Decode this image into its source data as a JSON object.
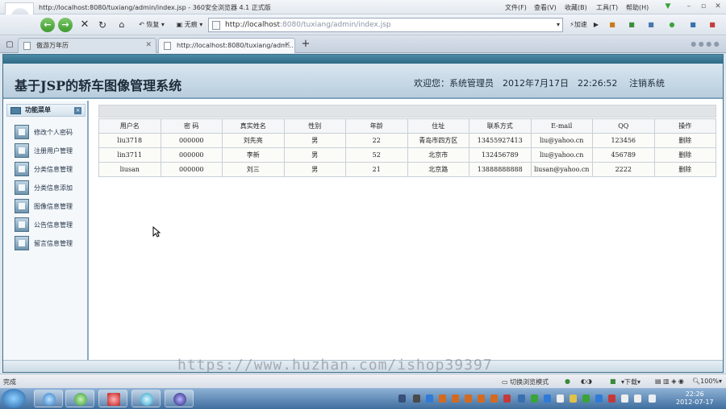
{
  "browser": {
    "title": "http://localhost:8080/tuxiang/admin/index.jsp - 360安全浏览器 4.1 正式版",
    "menu": [
      "文件(F)",
      "查看(V)",
      "收藏(B)",
      "工具(T)",
      "帮助(H)"
    ],
    "url_host": "http://localhost",
    "url_rest": ":8080/tuxiang/admin/index.jsp",
    "nav_back_label": "恢复",
    "nav_no_trace_label": "无痕",
    "accelerate_label": "加速",
    "tabs": [
      {
        "label": "傲游万年历"
      },
      {
        "label": "http://localhost:8080/tuxiang/adm..."
      }
    ]
  },
  "app": {
    "system_name": "基于JSP的轿车图像管理系统",
    "welcome": "欢迎您：系统管理员　2012年7月17日　22:26:52",
    "logout": "注销系统",
    "sidebar_title": "功能菜单",
    "sidebar_items": [
      {
        "label": "修改个人密码"
      },
      {
        "label": "注册用户管理"
      },
      {
        "label": "分类信息管理"
      },
      {
        "label": "分类信息添加"
      },
      {
        "label": "图像信息管理"
      },
      {
        "label": "公告信息管理"
      },
      {
        "label": "留言信息管理"
      }
    ],
    "table": {
      "headers": [
        "用户名",
        "密 码",
        "真实姓名",
        "性别",
        "年龄",
        "住址",
        "联系方式",
        "E-mail",
        "QQ",
        "操作"
      ],
      "rows": [
        [
          "liu3718",
          "000000",
          "刘先亮",
          "男",
          "22",
          "青岛市四方区",
          "13455927413",
          "liu@yahoo.cn",
          "123456",
          "删除"
        ],
        [
          "lin3711",
          "000000",
          "李新",
          "男",
          "52",
          "北京市",
          "132456789",
          "liu@yahoo.cn",
          "456789",
          "删除"
        ],
        [
          "liusan",
          "000000",
          "刘三",
          "男",
          "21",
          "北京路",
          "13888888888",
          "liusan@yahoo.cn",
          "2222",
          "删除"
        ]
      ]
    }
  },
  "status": {
    "left": "完成",
    "switch_mode": "切换浏览模式",
    "download": "下载",
    "zoom": "100%"
  },
  "watermark": "https://www.huzhan.com/ishop39397",
  "taskbar": {
    "time": "22:26",
    "date": "2012-07-17"
  }
}
